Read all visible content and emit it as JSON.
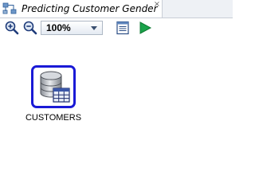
{
  "tab": {
    "title": "Predicting Customer Gender",
    "close_glyph": "×",
    "icon": "workflow-icon"
  },
  "toolbar": {
    "zoom_in_icon": "zoom-in-icon",
    "zoom_out_icon": "zoom-out-icon",
    "zoom_level": "100%",
    "properties_icon": "properties-icon",
    "run_icon": "run-icon"
  },
  "canvas": {
    "node": {
      "label": "CUSTOMERS",
      "icon": "data-source-icon",
      "selected_border_color": "#1a1ad6"
    }
  }
}
